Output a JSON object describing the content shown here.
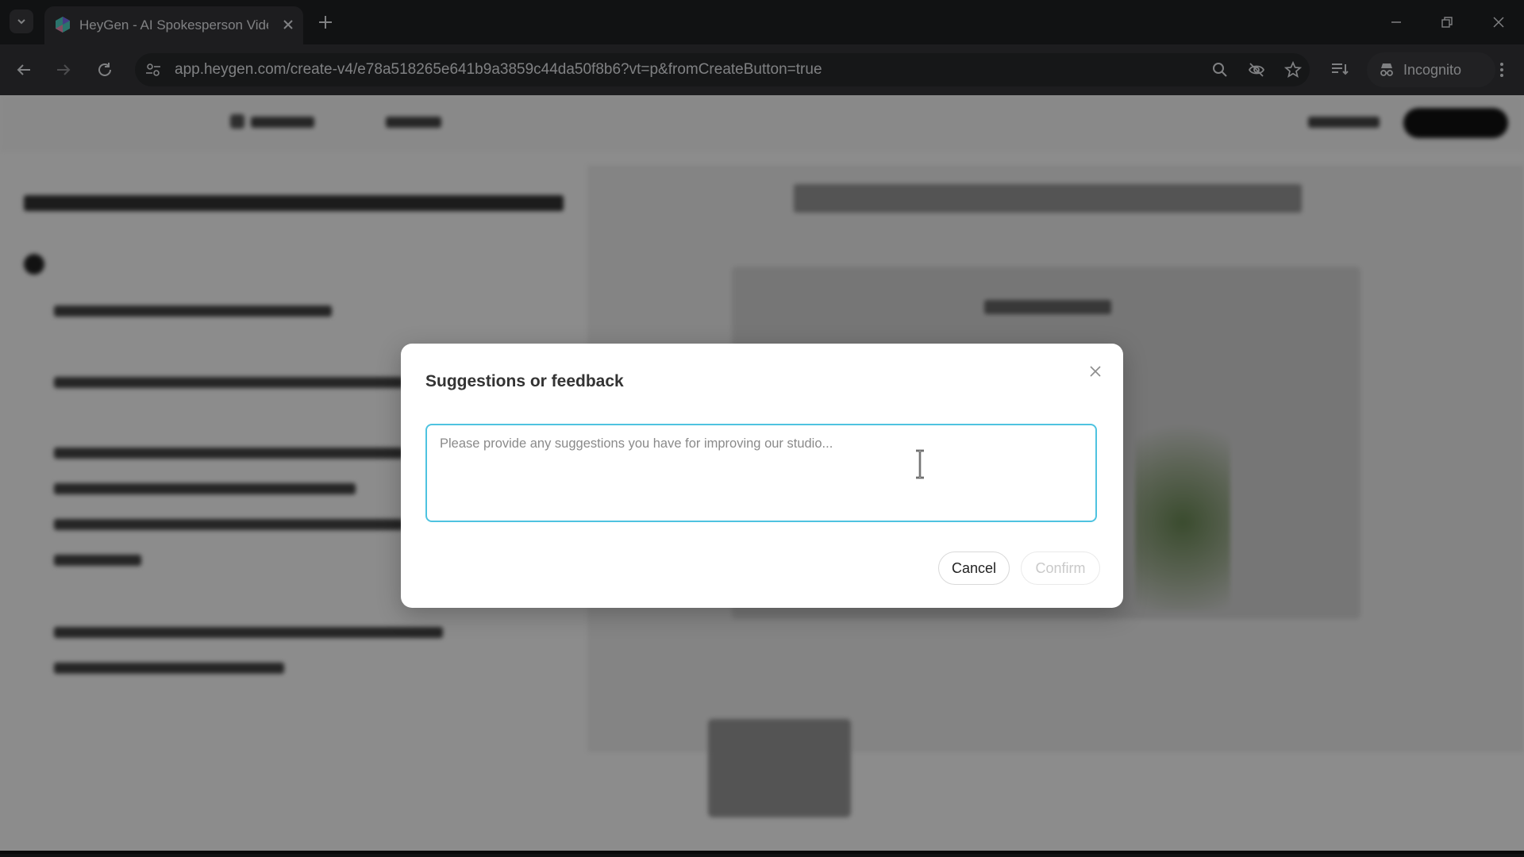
{
  "browser": {
    "tab": {
      "title": "HeyGen - AI Spokesperson Vide"
    },
    "address": {
      "url": "app.heygen.com/create-v4/e78a518265e641b9a3859c44da50f8b6?vt=p&fromCreateButton=true"
    },
    "incognito_label": "Incognito",
    "icons": [
      "tab-list-icon",
      "favicon-heygen-icon",
      "close-icon",
      "plus-icon",
      "minimize-icon",
      "restore-icon",
      "window-close-icon",
      "back-arrow-icon",
      "forward-arrow-icon",
      "reload-icon",
      "site-info-icon",
      "zoom-icon",
      "eye-off-icon",
      "star-icon",
      "reading-list-icon",
      "incognito-icon",
      "kebab-menu-icon"
    ]
  },
  "modal": {
    "title": "Suggestions or feedback",
    "input": {
      "placeholder": "Please provide any suggestions you have for improving our studio...",
      "value": ""
    },
    "cancel_label": "Cancel",
    "confirm_label": "Confirm",
    "confirm_enabled": false
  },
  "colors": {
    "input_focus_border": "#4ec3e0",
    "overlay": "rgba(0,0,0,0.45)",
    "browser_frame": "#202124"
  }
}
